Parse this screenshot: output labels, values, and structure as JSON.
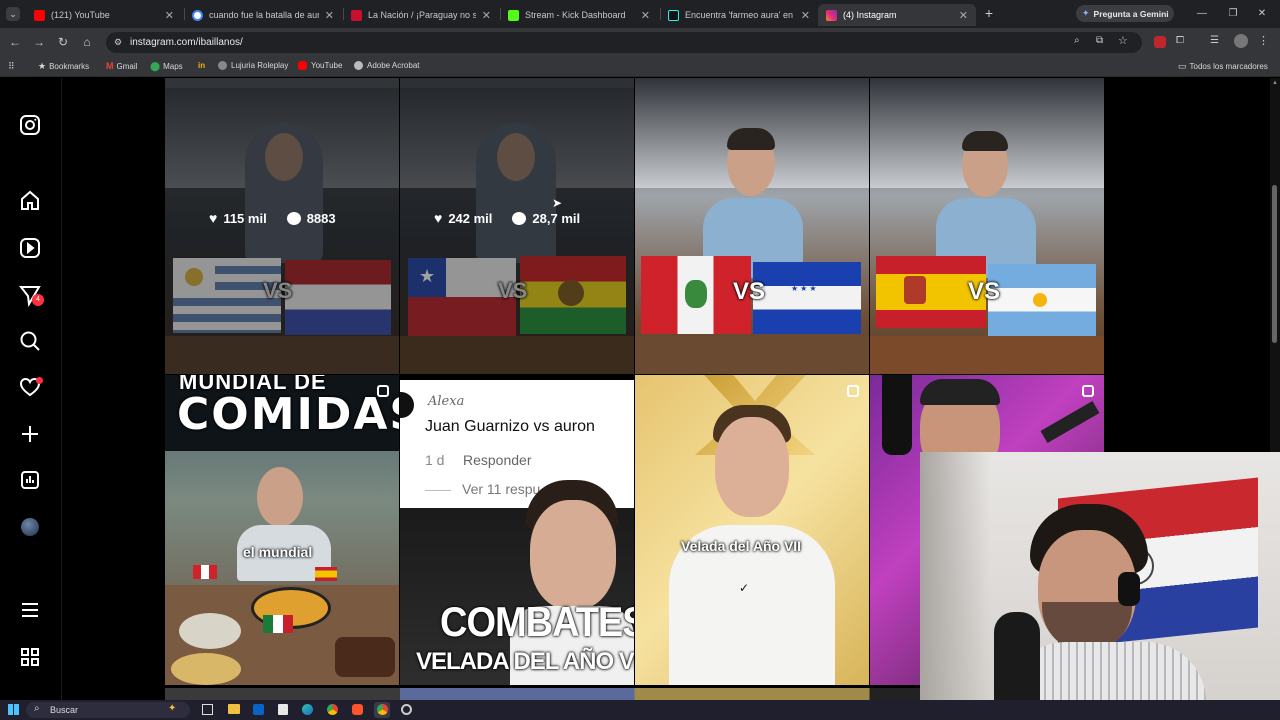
{
  "browser": {
    "tabs": [
      {
        "title": "(121) YouTube",
        "fav_color": "#ff0000"
      },
      {
        "title": "cuando fue la batalla de aura e",
        "fav_color": "#4285f4"
      },
      {
        "title": "La Nación / ¡Paraguay no se sal",
        "fav_color": "#c8102e"
      },
      {
        "title": "Stream - Kick Dashboard",
        "fav_color": "#53fc18"
      },
      {
        "title": "Encuentra 'farmeo aura' en Tik",
        "fav_color": "#111111"
      },
      {
        "title": "(4) Instagram",
        "fav_color": "#e1306c"
      }
    ],
    "new_tab": "+",
    "gemini_button": "Pregunta a Gemini",
    "url": "instagram.com/ibaillanos/",
    "bookmarks": [
      {
        "label": "Bookmarks",
        "color": "#ffffff"
      },
      {
        "label": "Gmail",
        "color": "#ea4335"
      },
      {
        "label": "Maps",
        "color": "#34a853"
      },
      {
        "label": "",
        "color": "#f4b400"
      },
      {
        "label": "Lujuria Roleplay",
        "color": "#888888"
      },
      {
        "label": "YouTube",
        "color": "#ff0000"
      },
      {
        "label": "Adobe Acrobat",
        "color": "#bbbbbb"
      }
    ],
    "all_bookmarks": "Todos los marcadores"
  },
  "instagram": {
    "nav": [
      {
        "name": "instagram-logo-icon"
      },
      {
        "name": "home-icon"
      },
      {
        "name": "reels-icon"
      },
      {
        "name": "messages-icon",
        "badge": "4"
      },
      {
        "name": "search-icon"
      },
      {
        "name": "notifications-icon"
      },
      {
        "name": "create-icon"
      },
      {
        "name": "dashboard-icon"
      },
      {
        "name": "profile-avatar"
      },
      {
        "name": "menu-icon"
      },
      {
        "name": "more-apps-icon"
      }
    ],
    "posts_row1": [
      {
        "likes": "115 mil",
        "comments": "8883",
        "vs": "VS"
      },
      {
        "likes": "242 mil",
        "comments": "28,7 mil",
        "vs": "VS"
      },
      {
        "vs": "VS"
      },
      {
        "vs": "VS"
      }
    ],
    "posts_row2": [
      {
        "headline": "MUNDIAL DE",
        "title": "COMIDAS",
        "caption": "el mundial"
      },
      {
        "comment_user": "Alexa",
        "comment_text": "Juan Guarnizo vs auron",
        "comment_age": "1 d",
        "reply": "Responder",
        "view_replies": "Ver 11 respu",
        "title1": "COMBATES",
        "title2": "VELADA DEL AÑO VII"
      },
      {
        "caption": "Velada del Año VII"
      },
      {}
    ]
  },
  "taskbar": {
    "search_placeholder": "Buscar"
  }
}
